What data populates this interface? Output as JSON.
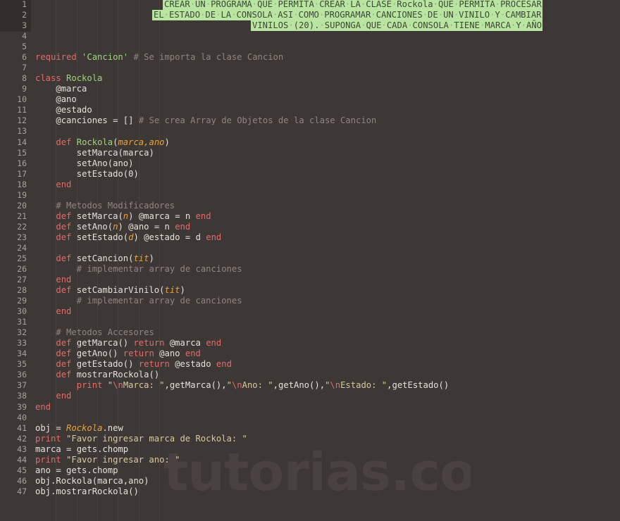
{
  "editor": {
    "theme_name": "dark-warm",
    "background_color": "#3d3735",
    "gutter_selected_color": "#332e2c",
    "highlight_color": "#b9e4a1",
    "highlight_text_color": "#3b4a33",
    "total_lines": 47,
    "language": "ruby"
  },
  "watermark": {
    "text": "tutorias.co",
    "color": "#4a4240"
  },
  "line_numbers": [
    "1",
    "2",
    "3",
    "4",
    "5",
    "6",
    "7",
    "8",
    "9",
    "10",
    "11",
    "12",
    "13",
    "14",
    "15",
    "16",
    "17",
    "18",
    "19",
    "20",
    "21",
    "22",
    "23",
    "24",
    "25",
    "26",
    "27",
    "28",
    "29",
    "30",
    "31",
    "32",
    "33",
    "34",
    "35",
    "36",
    "37",
    "38",
    "39",
    "40",
    "41",
    "42",
    "43",
    "44",
    "45",
    "46",
    "47"
  ],
  "selected_lines": [
    "1",
    "2",
    "3"
  ],
  "highlighted_comment": {
    "line_1": "CREAR UN PROGRAMA QUE PERMITA CREAR LA CLASE Rockola QUE PERMITA PROCESAR",
    "line_2": "EL ESTADO DE LA CONSOLA ASI COMO PROGRAMAR CANCIONES DE UN VINILO Y CAMBIAR",
    "line_3": "VINILOS (20). SUPONGA QUE CADA CONSOLA TIENE MARCA Y AÑO"
  },
  "code_lines": {
    "6": {
      "text": "required 'Cancion' # Se importa la clase Cancion"
    },
    "8": {
      "text": "class Rockola"
    },
    "9": {
      "text": "    @marca"
    },
    "10": {
      "text": "    @ano"
    },
    "11": {
      "text": "    @estado"
    },
    "12": {
      "text": "    @canciones = [] # Se crea Array de Objetos de la clase Cancion"
    },
    "14": {
      "text": "    def Rockola(marca,ano)"
    },
    "15": {
      "text": "        setMarca(marca)"
    },
    "16": {
      "text": "        setAno(ano)"
    },
    "17": {
      "text": "        setEstado(0)"
    },
    "18": {
      "text": "    end"
    },
    "20": {
      "text": "    # Metodos Modificadores"
    },
    "21": {
      "text": "    def setMarca(n) @marca = n end"
    },
    "22": {
      "text": "    def setAno(n) @ano = n end"
    },
    "23": {
      "text": "    def setEstado(d) @estado = d end"
    },
    "25": {
      "text": "    def setCancion(tit)"
    },
    "26": {
      "text": "        # implementar array de canciones"
    },
    "27": {
      "text": "    end"
    },
    "28": {
      "text": "    def setCambiarVinilo(tit)"
    },
    "29": {
      "text": "        # implementar array de canciones"
    },
    "30": {
      "text": "    end"
    },
    "32": {
      "text": "    # Metodos Accesores"
    },
    "33": {
      "text": "    def getMarca() return @marca end"
    },
    "34": {
      "text": "    def getAno() return @ano end"
    },
    "35": {
      "text": "    def getEstado() return @estado end"
    },
    "36": {
      "text": "    def mostrarRockola()"
    },
    "37": {
      "text": "        print \"\\nMarca: \",getMarca(),\"\\nAno: \",getAno(),\"\\nEstado: \",getEstado()"
    },
    "38": {
      "text": "    end"
    },
    "39": {
      "text": "end"
    },
    "41": {
      "text": "obj = Rockola.new"
    },
    "42": {
      "text": "print \"Favor ingresar marca de Rockola: \""
    },
    "43": {
      "text": "marca = gets.chomp"
    },
    "44": {
      "text": "print \"Favor ingresar ano: \""
    },
    "45": {
      "text": "ano = gets.chomp"
    },
    "46": {
      "text": "obj.Rockola(marca,ano)"
    },
    "47": {
      "text": "obj.mostrarRockola()"
    }
  }
}
